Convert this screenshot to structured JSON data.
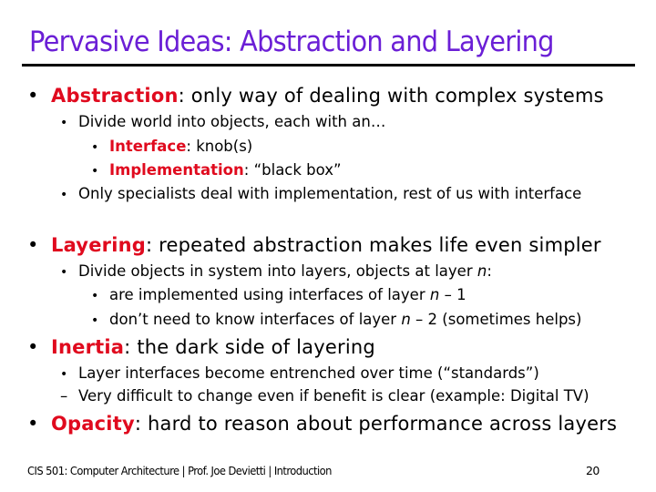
{
  "slide": {
    "title": "Pervasive Ideas: Abstraction and Layering",
    "colors": {
      "title": "#6b1fd6",
      "keyword": "#e00a1e",
      "text": "#000000"
    },
    "bullets": [
      {
        "keyword": "Abstraction",
        "text": ": only way of dealing with complex systems",
        "sub": [
          {
            "text": "Divide world into objects, each with an…",
            "sub": [
              {
                "keyword": "Interface",
                "text": ": knob(s)"
              },
              {
                "keyword": "Implementation",
                "text": ": “black box”"
              }
            ]
          },
          {
            "text": "Only specialists deal with implementation, rest of us with interface"
          }
        ]
      },
      {
        "keyword": "Layering",
        "text": ": repeated abstraction makes life even simpler",
        "sub": [
          {
            "text_before": "Divide objects in system into layers, objects at layer ",
            "var": "n",
            "text_after": ":",
            "sub": [
              {
                "text_before": "are implemented using interfaces of layer ",
                "var": "n",
                "text_after": " – 1"
              },
              {
                "text_before": "don’t need to know interfaces of layer ",
                "var": "n",
                "text_after": " – 2 (sometimes helps)"
              }
            ]
          }
        ]
      },
      {
        "keyword": "Inertia",
        "text": ": the dark side of layering",
        "sub": [
          {
            "text": "Layer interfaces become entrenched over time (“standards”)"
          },
          {
            "marker": "–",
            "text": "Very difficult to change even if benefit is clear (example: Digital TV)"
          }
        ]
      },
      {
        "keyword": "Opacity",
        "text": ": hard to reason about performance across layers"
      }
    ],
    "bullet_glyph": "•",
    "footer": {
      "course": "CIS 501: Computer Architecture",
      "separator": "|",
      "instructor": "Prof. Joe Devietti",
      "section": "Introduction",
      "page_number": "20"
    }
  }
}
